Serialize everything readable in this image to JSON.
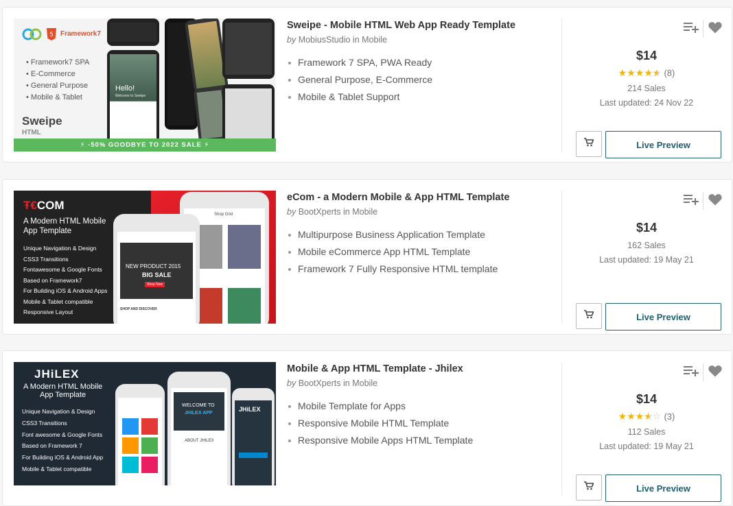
{
  "items": [
    {
      "title": "Sweipe - Mobile HTML Web App Ready Template",
      "by": "by",
      "author": "MobiusStudio",
      "in": "in",
      "category": "Mobile",
      "features": [
        "Framework 7 SPA, PWA Ready",
        "General Purpose, E-Commerce",
        "Mobile & Tablet Support"
      ],
      "price": "$14",
      "rating": 4.5,
      "rating_count": "(8)",
      "sales": "214 Sales",
      "updated": "Last updated: 24 Nov 22",
      "preview_label": "Live Preview",
      "thumb": {
        "brand": "Framework7",
        "bullets": [
          "Framework7 SPA",
          "E-Commerce",
          "General Purpose",
          "Mobile & Tablet"
        ],
        "name": "Sweipe",
        "sub": "HTML",
        "banner": "⚡ -50% GOODBYE TO 2022 SALE ⚡",
        "screen_text": "Hello!",
        "screen_sub": "Welcome to Sweipe"
      }
    },
    {
      "title": "eCom - a Modern Mobile & App HTML Template",
      "by": "by",
      "author": "BootXperts",
      "in": "in",
      "category": "Mobile",
      "features": [
        "Multipurpose Business Application Template",
        "Mobile eCommerce App HTML Template",
        "Framework 7 Fully Responsive HTML template"
      ],
      "price": "$14",
      "sales": "162 Sales",
      "updated": "Last updated: 19 May 21",
      "preview_label": "Live Preview",
      "thumb": {
        "logo": "COM",
        "heading": "A Modern HTML Mobile App Template",
        "bullets": [
          "Unique Navigation & Design",
          "CSS3 Transitions",
          "Fontawesome & Google Fonts",
          "Based on Framework7",
          "For Building iOS & Android Apps",
          "Mobile & Tablet compatible",
          "Responsive Layout"
        ],
        "promo1": "NEW PRODUCT 2015",
        "promo2": "BIG SALE",
        "shop": "Shop Now",
        "grid_title": "Shop Grid",
        "discover": "SHOP AND DISCOVER"
      }
    },
    {
      "title": "Mobile & App HTML Template - Jhilex",
      "by": "by",
      "author": "BootXperts",
      "in": "in",
      "category": "Mobile",
      "features": [
        "Mobile Template for Apps",
        "Responsive Mobile HTML Template",
        "Responsive Mobile Apps HTML Template"
      ],
      "price": "$14",
      "rating": 3.5,
      "rating_count": "(3)",
      "sales": "112 Sales",
      "updated": "Last updated: 19 May 21",
      "preview_label": "Live Preview",
      "thumb": {
        "logo": "JHiLEX",
        "heading1": "A Modern HTML Mobile",
        "heading2": "App Template",
        "bullets": [
          "Unique Navigation & Design",
          "CSS3 Transitions",
          "Font awesome & Google Fonts",
          "Based on Framework 7",
          "For Building iOS & Android App",
          "Mobile & Tablet compatible"
        ],
        "welcome": "WELCOME TO",
        "app": "JHILEX APP",
        "about": "ABOUT JHILEX"
      }
    }
  ],
  "colors": {
    "accent": "#1f5f70",
    "star": "#f5b400",
    "banner": "#5cb85c",
    "ecom_red": "#e5202a"
  },
  "icons": {
    "collection": "playlist-add-icon",
    "favorite": "heart-icon",
    "cart": "cart-icon"
  }
}
